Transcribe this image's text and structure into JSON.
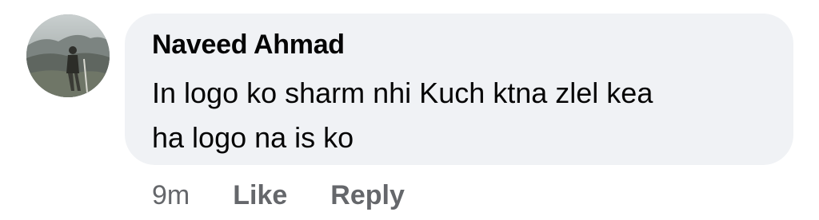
{
  "comment": {
    "author": "Naveed Ahmad",
    "text_lines": [
      "In logo ko sharm nhi Kuch ktna zlel kea",
      "ha logo na is ko"
    ],
    "avatar_icon": "profile-photo-hiker",
    "timestamp": "9m",
    "actions": {
      "like_label": "Like",
      "reply_label": "Reply"
    },
    "colors": {
      "bubble_background": "#f0f2f5",
      "text": "#050505",
      "meta_text": "#65676b"
    }
  }
}
